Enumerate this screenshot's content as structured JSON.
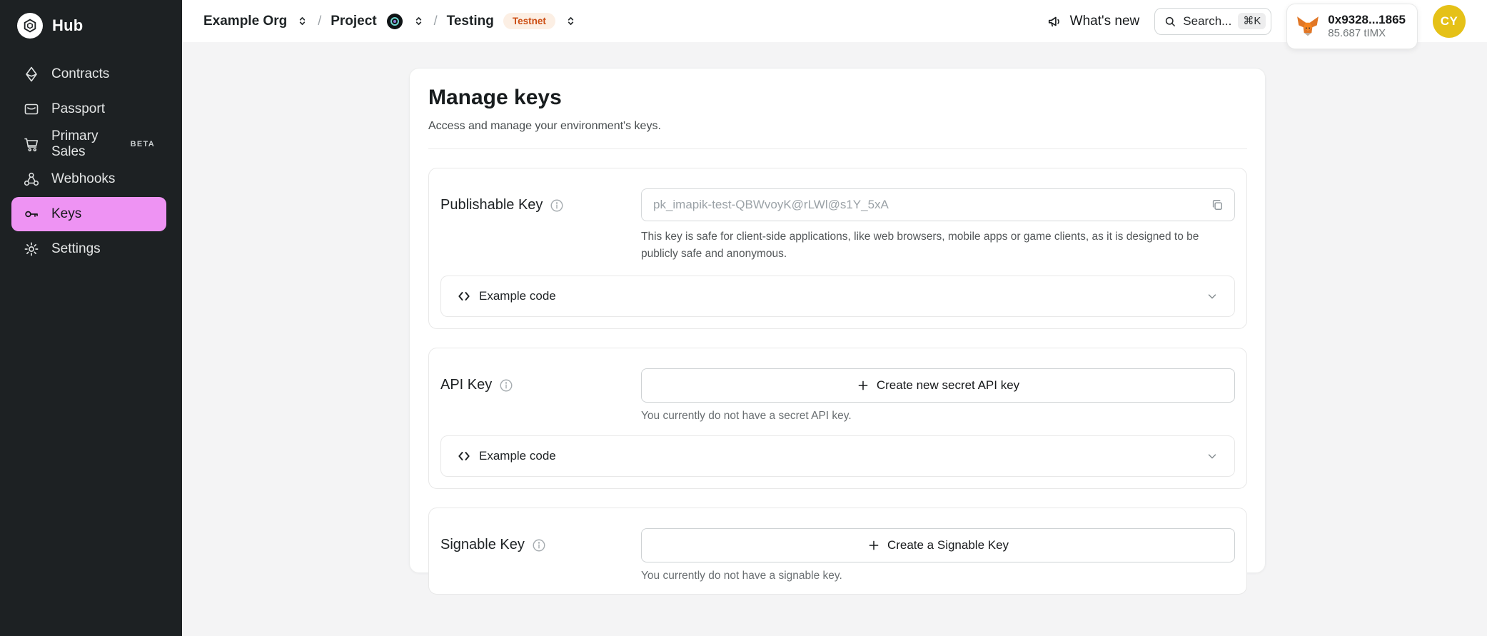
{
  "sidebar": {
    "logo_text": "Hub",
    "items": [
      {
        "label": "Contracts"
      },
      {
        "label": "Passport"
      },
      {
        "label": "Primary Sales",
        "badge": "BETA"
      },
      {
        "label": "Webhooks"
      },
      {
        "label": "Keys",
        "active": true
      },
      {
        "label": "Settings"
      }
    ]
  },
  "navbar": {
    "breadcrumb": {
      "org": "Example Org",
      "sep1": "/",
      "project": "Project",
      "sep2": "/",
      "environment": "Testing",
      "env_badge": "Testnet"
    },
    "whats_new": "What's new",
    "search": {
      "placeholder": "Search...",
      "shortcut": "⌘K"
    },
    "wallet": {
      "address": "0x9328...1865",
      "balance": "85.687 tIMX"
    },
    "avatar_initials": "CY"
  },
  "main": {
    "title": "Manage keys",
    "subtitle": "Access and manage your environment's keys.",
    "publishable": {
      "label": "Publishable Key",
      "value": "pk_imapik-test-QBWvoyK@rLWl@s1Y_5xA",
      "help": "This key is safe for client-side applications, like web browsers, mobile apps or game clients, as it is designed to be publicly safe and anonymous.",
      "example_code": "Example code"
    },
    "api": {
      "label": "API Key",
      "button": "Create new secret API key",
      "help": "You currently do not have a secret API key.",
      "example_code": "Example code"
    },
    "signable": {
      "label": "Signable Key",
      "button": "Create a Signable Key",
      "help": "You currently do not have a signable key."
    }
  },
  "colors": {
    "sidebar_bg": "#1d2123",
    "active_item_pink": "#ee93f3",
    "page_bg": "#f4f4f5",
    "testnet_badge_text": "#cc4e14",
    "testnet_badge_bg": "#fcefe4",
    "avatar_bg": "#e5c117",
    "fox_orange": "#e17726"
  }
}
